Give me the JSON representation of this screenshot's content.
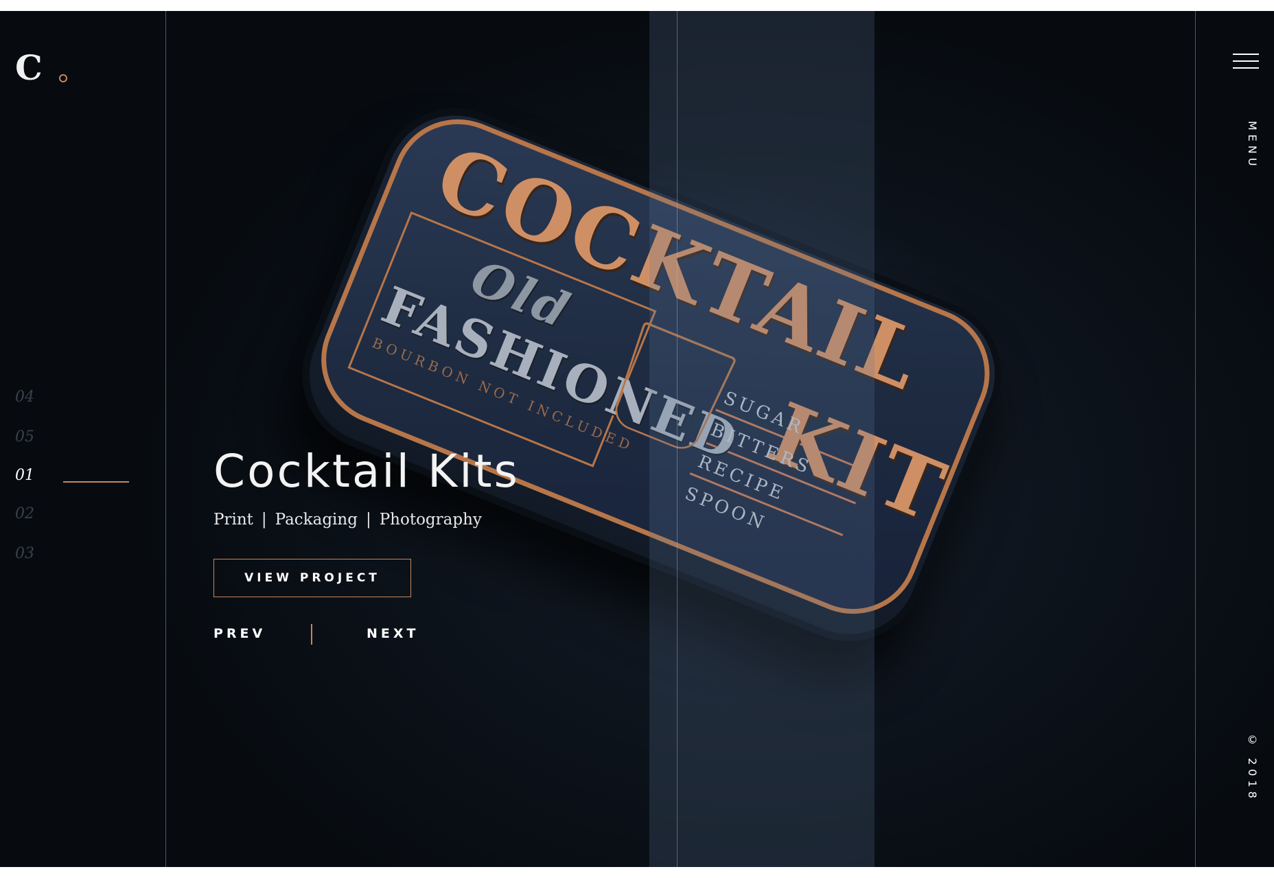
{
  "header": {
    "logo_letter": "C"
  },
  "slides": [
    "04",
    "05",
    "01",
    "02",
    "03"
  ],
  "active_slide": "01",
  "hero": {
    "title": "Cocktail Kits",
    "tags": [
      "Print",
      "Packaging",
      "Photography"
    ],
    "tag_separator": "|",
    "cta_label": "VIEW PROJECT",
    "prev_label": "PREV",
    "next_label": "NEXT"
  },
  "right_rail": {
    "menu_label": "MENU",
    "copyright": "© 2018"
  },
  "tin": {
    "cocktail": "COCKTAIL",
    "kit": "KIT",
    "old": "Old",
    "fashioned": "FASHIONED",
    "bourbon": "BOURBON NOT INCLUDED",
    "items": [
      "SUGAR",
      "BITTERS",
      "RECIPE",
      "SPOON"
    ]
  },
  "colors": {
    "accent": "#c8865f",
    "background": "#0f1620",
    "text": "#ffffff"
  }
}
